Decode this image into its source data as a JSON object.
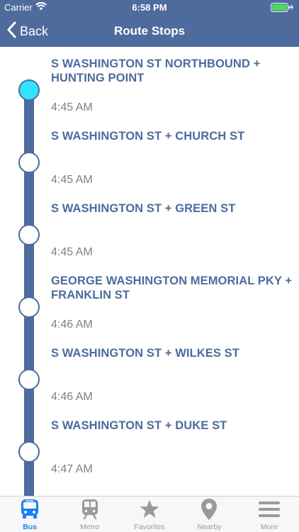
{
  "status_bar": {
    "carrier": "Carrier",
    "time": "6:58 PM"
  },
  "nav": {
    "back_label": "Back",
    "title": "Route Stops"
  },
  "stops": [
    {
      "name": "S WASHINGTON ST NORTHBOUND + HUNTING POINT",
      "time": "4:45 AM",
      "current": true
    },
    {
      "name": "S WASHINGTON ST + CHURCH ST",
      "time": "4:45 AM",
      "current": false
    },
    {
      "name": "S WASHINGTON ST + GREEN ST",
      "time": "4:45 AM",
      "current": false
    },
    {
      "name": "GEORGE WASHINGTON MEMORIAL PKY + FRANKLIN ST",
      "time": "4:46 AM",
      "current": false
    },
    {
      "name": "S WASHINGTON ST + WILKES ST",
      "time": "4:46 AM",
      "current": false
    },
    {
      "name": "S WASHINGTON ST + DUKE ST",
      "time": "4:47 AM",
      "current": false
    }
  ],
  "tabs": [
    {
      "label": "Bus",
      "icon": "bus-icon",
      "active": true
    },
    {
      "label": "Metro",
      "icon": "train-icon",
      "active": false
    },
    {
      "label": "Favorites",
      "icon": "star-icon",
      "active": false
    },
    {
      "label": "Nearby",
      "icon": "location-pin-icon",
      "active": false
    },
    {
      "label": "More",
      "icon": "menu-icon",
      "active": false
    }
  ],
  "colors": {
    "brand": "#4e6b9d",
    "current_stop": "#33e4ff",
    "tab_active": "#1a7ff2",
    "tab_inactive": "#9a9a9a"
  }
}
